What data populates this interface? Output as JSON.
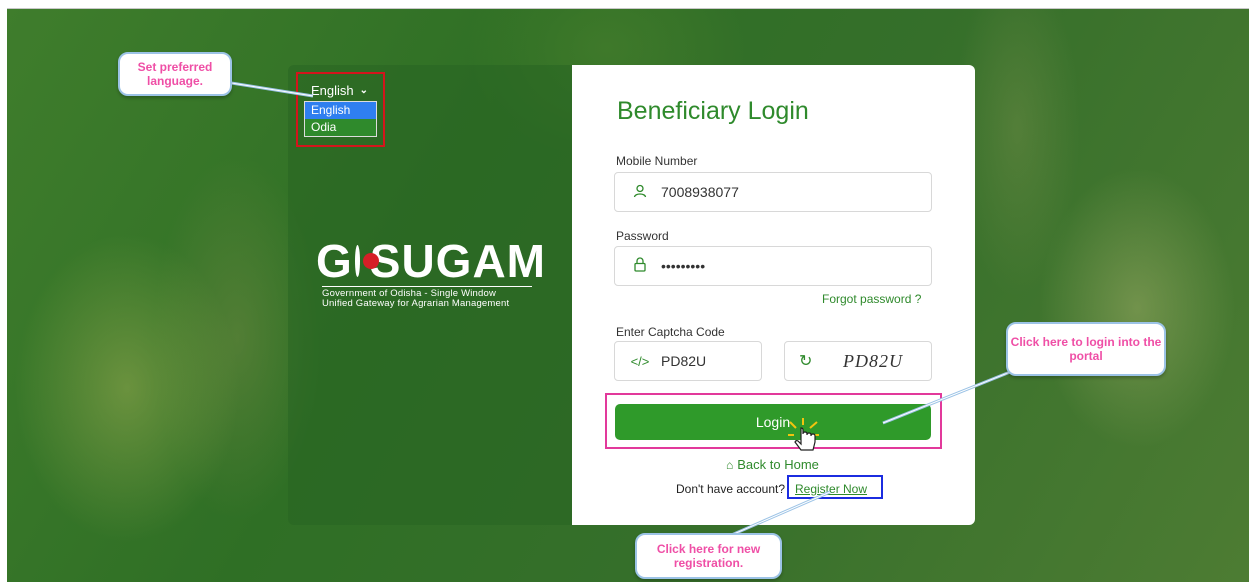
{
  "language": {
    "selected": "English",
    "options": [
      "English",
      "Odia"
    ]
  },
  "logo": {
    "name": "GO SUGAM",
    "name_left": "G",
    "name_right": "SUGAM",
    "tagline_1": "Government of Odisha - Single Window",
    "tagline_2": "Unified Gateway for Agrarian Management"
  },
  "login": {
    "title": "Beneficiary Login",
    "mobile_label": "Mobile Number",
    "mobile_value": "7008938077",
    "password_label": "Password",
    "password_value": "•••••••••",
    "forgot_label": "Forgot password ?",
    "captcha_label": "Enter Captcha Code",
    "captcha_value": "PD82U",
    "captcha_image_text": "PD82U",
    "login_button": "Login",
    "back_home": "Back to Home",
    "account_prompt": "Don't have account?",
    "register_link": "Register Now"
  },
  "callouts": {
    "language": "Set preferred language.",
    "login": "Click here to login into the portal",
    "register": "Click here for new registration."
  },
  "icons": {
    "user": "user-icon",
    "lock": "lock-icon",
    "code": "code-icon",
    "refresh": "refresh-icon",
    "home": "home-icon",
    "pointer": "hand-pointer-icon"
  },
  "colors": {
    "brand_green": "#2f8a2c",
    "button_green": "#2f9a2a",
    "callout_text": "#ef4fa6",
    "highlight_red": "#d3151c",
    "highlight_pink": "#e2399b",
    "highlight_blue": "#1b2ce0"
  }
}
